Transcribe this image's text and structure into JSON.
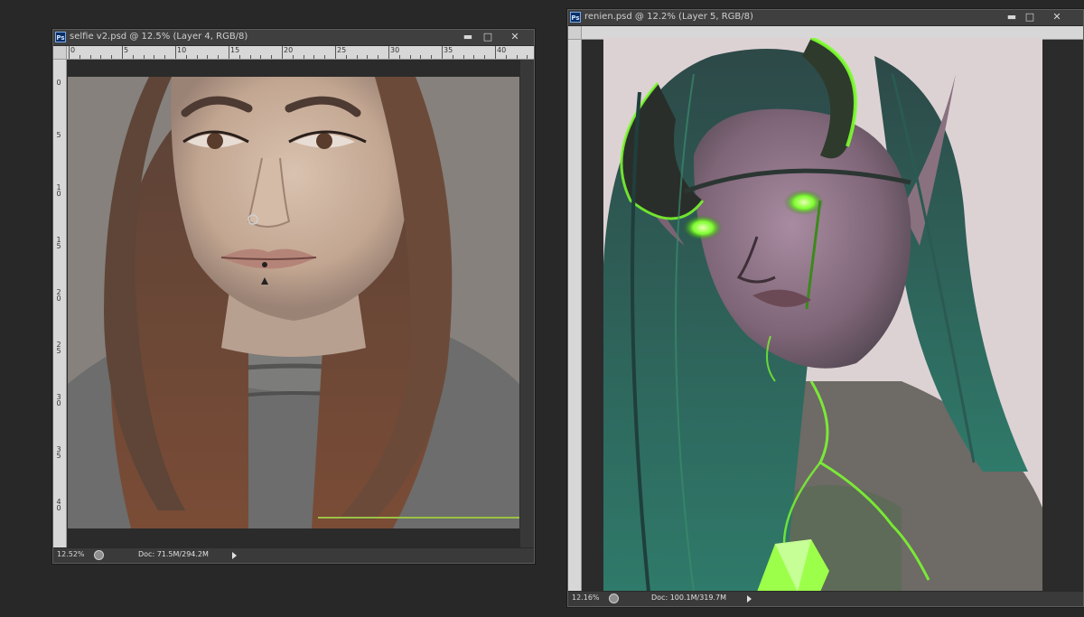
{
  "windows": [
    {
      "title": "selfie v2.psd @ 12.5% (Layer 4, RGB/8)",
      "logo": "Ps",
      "zoom": "12.52%",
      "doc": "Doc: 71.5M/294.2M",
      "ruler_h": [
        "0",
        "5",
        "10",
        "15",
        "20",
        "25",
        "30",
        "35",
        "40"
      ],
      "ruler_v": [
        "0",
        "5",
        "10",
        "15",
        "20",
        "25",
        "30",
        "35",
        "40"
      ]
    },
    {
      "title": "renien.psd @ 12.2% (Layer 5, RGB/8)",
      "logo": "Ps",
      "zoom": "12.16%",
      "doc": "Doc: 100.1M/319.7M"
    }
  ],
  "icons": {
    "minimize": "minimize-icon",
    "maximize": "maximize-icon",
    "close": "close-icon"
  },
  "colors": {
    "app_background": "#282828",
    "window_chrome": "#3b3b3b",
    "ruler": "#d7d7d7",
    "glow_green": "#7cff2e"
  }
}
